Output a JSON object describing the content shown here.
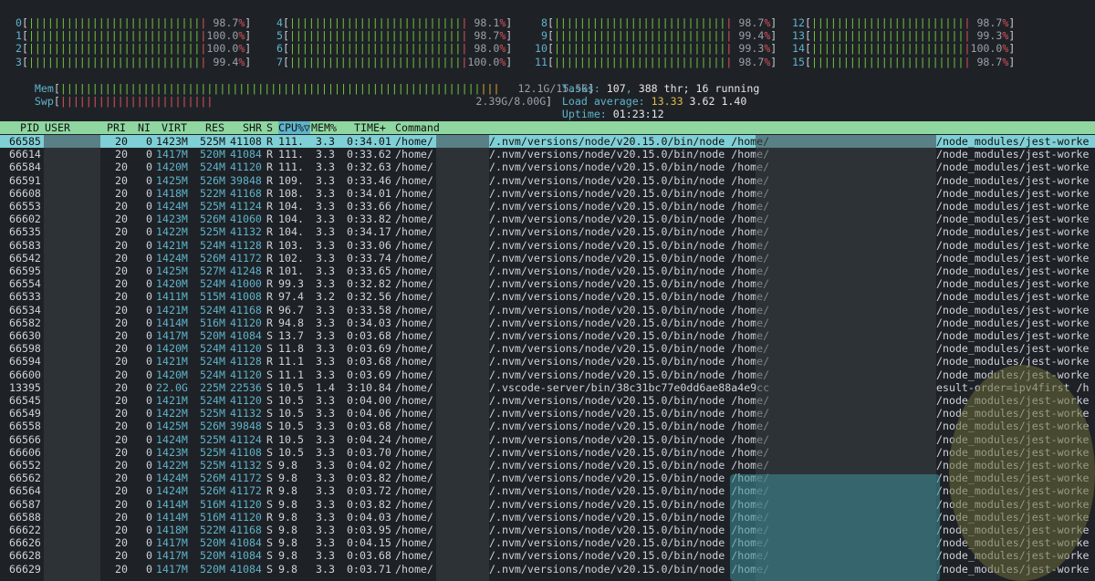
{
  "cpu_meters": [
    {
      "label": "0",
      "pct": "98.7%"
    },
    {
      "label": "1",
      "pct": "100.0%"
    },
    {
      "label": "2",
      "pct": "100.0%"
    },
    {
      "label": "3",
      "pct": "99.4%"
    },
    {
      "label": "4",
      "pct": "98.1%"
    },
    {
      "label": "5",
      "pct": "98.7%"
    },
    {
      "label": "6",
      "pct": "98.0%"
    },
    {
      "label": "7",
      "pct": "100.0%"
    },
    {
      "label": "8",
      "pct": "98.7%"
    },
    {
      "label": "9",
      "pct": "99.4%"
    },
    {
      "label": "10",
      "pct": "99.3%"
    },
    {
      "label": "11",
      "pct": "98.7%"
    },
    {
      "label": "12",
      "pct": "98.7%"
    },
    {
      "label": "13",
      "pct": "99.3%"
    },
    {
      "label": "14",
      "pct": "100.0%"
    },
    {
      "label": "15",
      "pct": "98.7%"
    }
  ],
  "mem": {
    "label": "Mem",
    "value": "12.1G/15.5G"
  },
  "swp": {
    "label": "Swp",
    "value": "2.39G/8.00G"
  },
  "tasks": {
    "label": "Tasks:",
    "count": "107",
    "thr": "388 thr;",
    "running": "16 running"
  },
  "load": {
    "label": "Load average:",
    "v1": "13.33",
    "v2": "3.62",
    "v3": "1.40"
  },
  "uptime": {
    "label": "Uptime:",
    "value": "01:23:12"
  },
  "columns": [
    "PID",
    "USER",
    "PRI",
    "NI",
    "VIRT",
    "RES",
    "SHR",
    "S",
    "CPU%▽",
    "MEM%",
    "TIME+",
    "Command"
  ],
  "processes": [
    {
      "pid": "66585",
      "pri": "20",
      "ni": "0",
      "virt": "1423M",
      "res": "525M",
      "shr": "41108",
      "s": "R",
      "cpu": "111.",
      "mem": "3.3",
      "time": "0:34.01",
      "cmd": "/home/",
      "cmd2": "/.nvm/versions/node/v20.15.0/bin/node /home/",
      "cmd3": "/node_modules/jest-worke"
    },
    {
      "pid": "66614",
      "pri": "20",
      "ni": "0",
      "virt": "1417M",
      "res": "520M",
      "shr": "41084",
      "s": "R",
      "cpu": "111.",
      "mem": "3.3",
      "time": "0:33.62",
      "cmd": "/home/",
      "cmd2": "/.nvm/versions/node/v20.15.0/bin/node /home/",
      "cmd3": "/node_modules/jest-worke"
    },
    {
      "pid": "66584",
      "pri": "20",
      "ni": "0",
      "virt": "1420M",
      "res": "524M",
      "shr": "41120",
      "s": "R",
      "cpu": "111.",
      "mem": "3.3",
      "time": "0:32.63",
      "cmd": "/home/",
      "cmd2": "/.nvm/versions/node/v20.15.0/bin/node /home/",
      "cmd3": "/node_modules/jest-worke"
    },
    {
      "pid": "66591",
      "pri": "20",
      "ni": "0",
      "virt": "1425M",
      "res": "526M",
      "shr": "39848",
      "s": "R",
      "cpu": "109.",
      "mem": "3.3",
      "time": "0:33.46",
      "cmd": "/home/",
      "cmd2": "/.nvm/versions/node/v20.15.0/bin/node /home/",
      "cmd3": "/node_modules/jest-worke"
    },
    {
      "pid": "66608",
      "pri": "20",
      "ni": "0",
      "virt": "1418M",
      "res": "522M",
      "shr": "41168",
      "s": "R",
      "cpu": "108.",
      "mem": "3.3",
      "time": "0:34.01",
      "cmd": "/home/",
      "cmd2": "/.nvm/versions/node/v20.15.0/bin/node /home/",
      "cmd3": "/node_modules/jest-worke"
    },
    {
      "pid": "66553",
      "pri": "20",
      "ni": "0",
      "virt": "1424M",
      "res": "525M",
      "shr": "41124",
      "s": "R",
      "cpu": "104.",
      "mem": "3.3",
      "time": "0:33.66",
      "cmd": "/home/",
      "cmd2": "/.nvm/versions/node/v20.15.0/bin/node /home/",
      "cmd3": "/node_modules/jest-worke"
    },
    {
      "pid": "66602",
      "pri": "20",
      "ni": "0",
      "virt": "1423M",
      "res": "526M",
      "shr": "41060",
      "s": "R",
      "cpu": "104.",
      "mem": "3.3",
      "time": "0:33.82",
      "cmd": "/home/",
      "cmd2": "/.nvm/versions/node/v20.15.0/bin/node /home/",
      "cmd3": "/node_modules/jest-worke"
    },
    {
      "pid": "66535",
      "pri": "20",
      "ni": "0",
      "virt": "1422M",
      "res": "525M",
      "shr": "41132",
      "s": "R",
      "cpu": "104.",
      "mem": "3.3",
      "time": "0:34.17",
      "cmd": "/home/",
      "cmd2": "/.nvm/versions/node/v20.15.0/bin/node /home/",
      "cmd3": "/node_modules/jest-worke"
    },
    {
      "pid": "66583",
      "pri": "20",
      "ni": "0",
      "virt": "1421M",
      "res": "524M",
      "shr": "41128",
      "s": "R",
      "cpu": "103.",
      "mem": "3.3",
      "time": "0:33.06",
      "cmd": "/home/",
      "cmd2": "/.nvm/versions/node/v20.15.0/bin/node /home/",
      "cmd3": "/node_modules/jest-worke"
    },
    {
      "pid": "66542",
      "pri": "20",
      "ni": "0",
      "virt": "1424M",
      "res": "526M",
      "shr": "41172",
      "s": "R",
      "cpu": "102.",
      "mem": "3.3",
      "time": "0:33.74",
      "cmd": "/home/",
      "cmd2": "/.nvm/versions/node/v20.15.0/bin/node /home/",
      "cmd3": "/node_modules/jest-worke"
    },
    {
      "pid": "66595",
      "pri": "20",
      "ni": "0",
      "virt": "1425M",
      "res": "527M",
      "shr": "41248",
      "s": "R",
      "cpu": "101.",
      "mem": "3.3",
      "time": "0:33.65",
      "cmd": "/home/",
      "cmd2": "/.nvm/versions/node/v20.15.0/bin/node /home/",
      "cmd3": "/node_modules/jest-worke"
    },
    {
      "pid": "66554",
      "pri": "20",
      "ni": "0",
      "virt": "1420M",
      "res": "524M",
      "shr": "41000",
      "s": "R",
      "cpu": "99.3",
      "mem": "3.3",
      "time": "0:32.82",
      "cmd": "/home/",
      "cmd2": "/.nvm/versions/node/v20.15.0/bin/node /home/",
      "cmd3": "/node_modules/jest-worke"
    },
    {
      "pid": "66533",
      "pri": "20",
      "ni": "0",
      "virt": "1411M",
      "res": "515M",
      "shr": "41008",
      "s": "R",
      "cpu": "97.4",
      "mem": "3.2",
      "time": "0:32.56",
      "cmd": "/home/",
      "cmd2": "/.nvm/versions/node/v20.15.0/bin/node /home/",
      "cmd3": "/node_modules/jest-worke"
    },
    {
      "pid": "66534",
      "pri": "20",
      "ni": "0",
      "virt": "1421M",
      "res": "524M",
      "shr": "41168",
      "s": "R",
      "cpu": "96.7",
      "mem": "3.3",
      "time": "0:33.58",
      "cmd": "/home/",
      "cmd2": "/.nvm/versions/node/v20.15.0/bin/node /home/",
      "cmd3": "/node_modules/jest-worke"
    },
    {
      "pid": "66582",
      "pri": "20",
      "ni": "0",
      "virt": "1414M",
      "res": "516M",
      "shr": "41120",
      "s": "R",
      "cpu": "94.8",
      "mem": "3.3",
      "time": "0:34.03",
      "cmd": "/home/",
      "cmd2": "/.nvm/versions/node/v20.15.0/bin/node /home/",
      "cmd3": "/node_modules/jest-worke"
    },
    {
      "pid": "66630",
      "pri": "20",
      "ni": "0",
      "virt": "1417M",
      "res": "520M",
      "shr": "41084",
      "s": "S",
      "cpu": "13.7",
      "mem": "3.3",
      "time": "0:03.68",
      "cmd": "/home/",
      "cmd2": "/.nvm/versions/node/v20.15.0/bin/node /home/",
      "cmd3": "/node_modules/jest-worke"
    },
    {
      "pid": "66598",
      "pri": "20",
      "ni": "0",
      "virt": "1420M",
      "res": "524M",
      "shr": "41120",
      "s": "S",
      "cpu": "11.8",
      "mem": "3.3",
      "time": "0:03.69",
      "cmd": "/home/",
      "cmd2": "/.nvm/versions/node/v20.15.0/bin/node /home/",
      "cmd3": "/node_modules/jest-worke"
    },
    {
      "pid": "66594",
      "pri": "20",
      "ni": "0",
      "virt": "1421M",
      "res": "524M",
      "shr": "41128",
      "s": "R",
      "cpu": "11.1",
      "mem": "3.3",
      "time": "0:03.68",
      "cmd": "/home/",
      "cmd2": "/.nvm/versions/node/v20.15.0/bin/node /home/",
      "cmd3": "/node_modules/jest-worke"
    },
    {
      "pid": "66600",
      "pri": "20",
      "ni": "0",
      "virt": "1420M",
      "res": "524M",
      "shr": "41120",
      "s": "S",
      "cpu": "11.1",
      "mem": "3.3",
      "time": "0:03.69",
      "cmd": "/home/",
      "cmd2": "/.nvm/versions/node/v20.15.0/bin/node /home/",
      "cmd3": "/node_modules/jest-worke"
    },
    {
      "pid": "13395",
      "pri": "20",
      "ni": "0",
      "virt": "22.0G",
      "res": "225M",
      "shr": "22536",
      "s": "S",
      "cpu": "10.5",
      "mem": "1.4",
      "time": "3:10.84",
      "cmd": "/home/",
      "cmd2": "/.vscode-server/bin/38c31bc77e0dd6ae88a4e9cc",
      "cmd3": "esult-order=ipv4first /h"
    },
    {
      "pid": "66545",
      "pri": "20",
      "ni": "0",
      "virt": "1421M",
      "res": "524M",
      "shr": "41120",
      "s": "S",
      "cpu": "10.5",
      "mem": "3.3",
      "time": "0:04.00",
      "cmd": "/home/",
      "cmd2": "/.nvm/versions/node/v20.15.0/bin/node /home/",
      "cmd3": "/node_modules/jest-worke"
    },
    {
      "pid": "66549",
      "pri": "20",
      "ni": "0",
      "virt": "1422M",
      "res": "525M",
      "shr": "41132",
      "s": "S",
      "cpu": "10.5",
      "mem": "3.3",
      "time": "0:04.06",
      "cmd": "/home/",
      "cmd2": "/.nvm/versions/node/v20.15.0/bin/node /home/",
      "cmd3": "/node_modules/jest-worke"
    },
    {
      "pid": "66558",
      "pri": "20",
      "ni": "0",
      "virt": "1425M",
      "res": "526M",
      "shr": "39848",
      "s": "S",
      "cpu": "10.5",
      "mem": "3.3",
      "time": "0:03.68",
      "cmd": "/home/",
      "cmd2": "/.nvm/versions/node/v20.15.0/bin/node /home/",
      "cmd3": "/node_modules/jest-worke"
    },
    {
      "pid": "66566",
      "pri": "20",
      "ni": "0",
      "virt": "1424M",
      "res": "525M",
      "shr": "41124",
      "s": "R",
      "cpu": "10.5",
      "mem": "3.3",
      "time": "0:04.24",
      "cmd": "/home/",
      "cmd2": "/.nvm/versions/node/v20.15.0/bin/node /home/",
      "cmd3": "/node_modules/jest-worke"
    },
    {
      "pid": "66606",
      "pri": "20",
      "ni": "0",
      "virt": "1423M",
      "res": "525M",
      "shr": "41108",
      "s": "S",
      "cpu": "10.5",
      "mem": "3.3",
      "time": "0:03.70",
      "cmd": "/home/",
      "cmd2": "/.nvm/versions/node/v20.15.0/bin/node /home/",
      "cmd3": "/node_modules/jest-worke"
    },
    {
      "pid": "66552",
      "pri": "20",
      "ni": "0",
      "virt": "1422M",
      "res": "525M",
      "shr": "41132",
      "s": "S",
      "cpu": "9.8",
      "mem": "3.3",
      "time": "0:04.02",
      "cmd": "/home/",
      "cmd2": "/.nvm/versions/node/v20.15.0/bin/node /home/",
      "cmd3": "/node_modules/jest-worke"
    },
    {
      "pid": "66562",
      "pri": "20",
      "ni": "0",
      "virt": "1424M",
      "res": "526M",
      "shr": "41172",
      "s": "S",
      "cpu": "9.8",
      "mem": "3.3",
      "time": "0:03.82",
      "cmd": "/home/",
      "cmd2": "/.nvm/versions/node/v20.15.0/bin/node /home/",
      "cmd3": "/node_modules/jest-worke"
    },
    {
      "pid": "66564",
      "pri": "20",
      "ni": "0",
      "virt": "1424M",
      "res": "526M",
      "shr": "41172",
      "s": "R",
      "cpu": "9.8",
      "mem": "3.3",
      "time": "0:03.72",
      "cmd": "/home/",
      "cmd2": "/.nvm/versions/node/v20.15.0/bin/node /home/",
      "cmd3": "/node_modules/jest-worke"
    },
    {
      "pid": "66587",
      "pri": "20",
      "ni": "0",
      "virt": "1414M",
      "res": "516M",
      "shr": "41120",
      "s": "S",
      "cpu": "9.8",
      "mem": "3.3",
      "time": "0:03.82",
      "cmd": "/home/",
      "cmd2": "/.nvm/versions/node/v20.15.0/bin/node /home/",
      "cmd3": "/node_modules/jest-worke"
    },
    {
      "pid": "66588",
      "pri": "20",
      "ni": "0",
      "virt": "1414M",
      "res": "516M",
      "shr": "41120",
      "s": "R",
      "cpu": "9.8",
      "mem": "3.3",
      "time": "0:04.03",
      "cmd": "/home/",
      "cmd2": "/.nvm/versions/node/v20.15.0/bin/node /home/",
      "cmd3": "/node_modules/jest-worke"
    },
    {
      "pid": "66622",
      "pri": "20",
      "ni": "0",
      "virt": "1418M",
      "res": "522M",
      "shr": "41168",
      "s": "S",
      "cpu": "9.8",
      "mem": "3.3",
      "time": "0:03.95",
      "cmd": "/home/",
      "cmd2": "/.nvm/versions/node/v20.15.0/bin/node /home/",
      "cmd3": "/node_modules/jest-worke"
    },
    {
      "pid": "66626",
      "pri": "20",
      "ni": "0",
      "virt": "1417M",
      "res": "520M",
      "shr": "41084",
      "s": "S",
      "cpu": "9.8",
      "mem": "3.3",
      "time": "0:04.15",
      "cmd": "/home/",
      "cmd2": "/.nvm/versions/node/v20.15.0/bin/node /home/",
      "cmd3": "/node_modules/jest-worke"
    },
    {
      "pid": "66628",
      "pri": "20",
      "ni": "0",
      "virt": "1417M",
      "res": "520M",
      "shr": "41084",
      "s": "S",
      "cpu": "9.8",
      "mem": "3.3",
      "time": "0:03.68",
      "cmd": "/home/",
      "cmd2": "/.nvm/versions/node/v20.15.0/bin/node /home/",
      "cmd3": "/node_modules/jest-worke"
    },
    {
      "pid": "66629",
      "pri": "20",
      "ni": "0",
      "virt": "1417M",
      "res": "520M",
      "shr": "41084",
      "s": "S",
      "cpu": "9.8",
      "mem": "3.3",
      "time": "0:03.71",
      "cmd": "/home/",
      "cmd2": "/.nvm/versions/node/v20.15.0/bin/node /home/",
      "cmd3": "/node_modules/jest-worke"
    }
  ]
}
